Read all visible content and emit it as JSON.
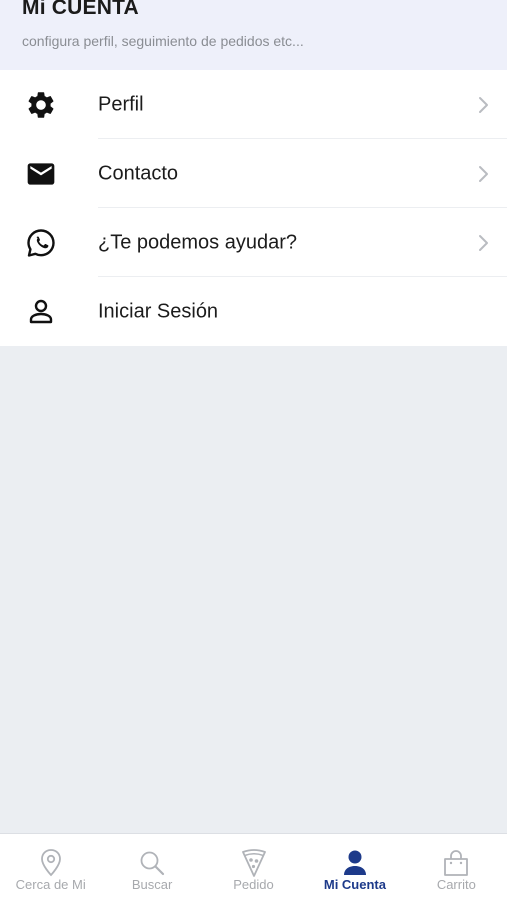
{
  "header": {
    "title": "Mi CUENTA",
    "subtitle": "configura perfil, seguimiento de pedidos etc..."
  },
  "menu": {
    "items": [
      {
        "label": "Perfil",
        "icon": "gear-icon",
        "chevron": true
      },
      {
        "label": "Contacto",
        "icon": "envelope-icon",
        "chevron": true
      },
      {
        "label": "¿Te podemos ayudar?",
        "icon": "whatsapp-icon",
        "chevron": true
      },
      {
        "label": "Iniciar Sesión",
        "icon": "user-icon",
        "chevron": false
      }
    ]
  },
  "tabbar": {
    "active_tab": "Mi Cuenta",
    "active_color": "#1d3a8a",
    "inactive_color": "#a7a9ad",
    "tabs": [
      {
        "label": "Cerca de Mi",
        "icon": "location-pin-icon"
      },
      {
        "label": "Buscar",
        "icon": "search-icon"
      },
      {
        "label": "Pedido",
        "icon": "pizza-slice-icon"
      },
      {
        "label": "Mi Cuenta",
        "icon": "account-icon"
      },
      {
        "label": "Carrito",
        "icon": "shopping-bag-icon"
      }
    ]
  }
}
